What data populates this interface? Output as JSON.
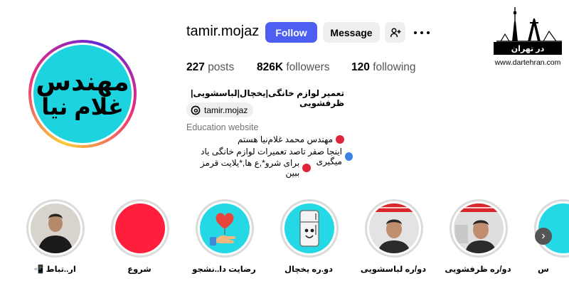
{
  "profile": {
    "username": "tamir.mojaz",
    "avatar_text_line1": "مهندس",
    "avatar_text_line2": "غلام نیا",
    "follow_label": "Follow",
    "message_label": "Message",
    "stats": {
      "posts_count": "227",
      "posts_label": "posts",
      "followers_count": "826K",
      "followers_label": "followers",
      "following_count": "120",
      "following_label": "following"
    },
    "bio_name": "تعمیر لوازم خانگی|یخچال|لباسشویی|ظرفشویی",
    "threads_handle": "tamir.mojaz",
    "category": "Education website",
    "bio_lines": [
      {
        "text": "مهندس محمد غلام‌نیا هستم",
        "dot_color": "#e0243a"
      },
      {
        "text": "اینجا صفر تاصد تعمیرات لوازم خانگی یاد میگیری",
        "dot_color": "#3b82e6"
      },
      {
        "text": "برای شرو*,ع ها,*یلایت قرمز ببین",
        "dot_color": "#e0243a"
      }
    ]
  },
  "logo": {
    "brand_text": "در تهران",
    "site": "www.dartehran.com"
  },
  "highlights": [
    {
      "label": "ار..تباط",
      "icon": "phone-emoji-icon",
      "kind": "person"
    },
    {
      "label": "شروع",
      "kind": "red"
    },
    {
      "label": "رضایت دا..نشجو",
      "kind": "heart"
    },
    {
      "label": "دو.ره یخچال",
      "kind": "fridge"
    },
    {
      "label": "دو/ره لباسشویی",
      "kind": "person-washer"
    },
    {
      "label": "دو/ره ظرفشویی",
      "kind": "person-dish"
    },
    {
      "label": "س",
      "kind": "partial"
    }
  ],
  "colors": {
    "follow_bg": "#4c5ff1",
    "avatar_bg": "#1ed3e0",
    "highlight_red": "#ff1f3d"
  }
}
